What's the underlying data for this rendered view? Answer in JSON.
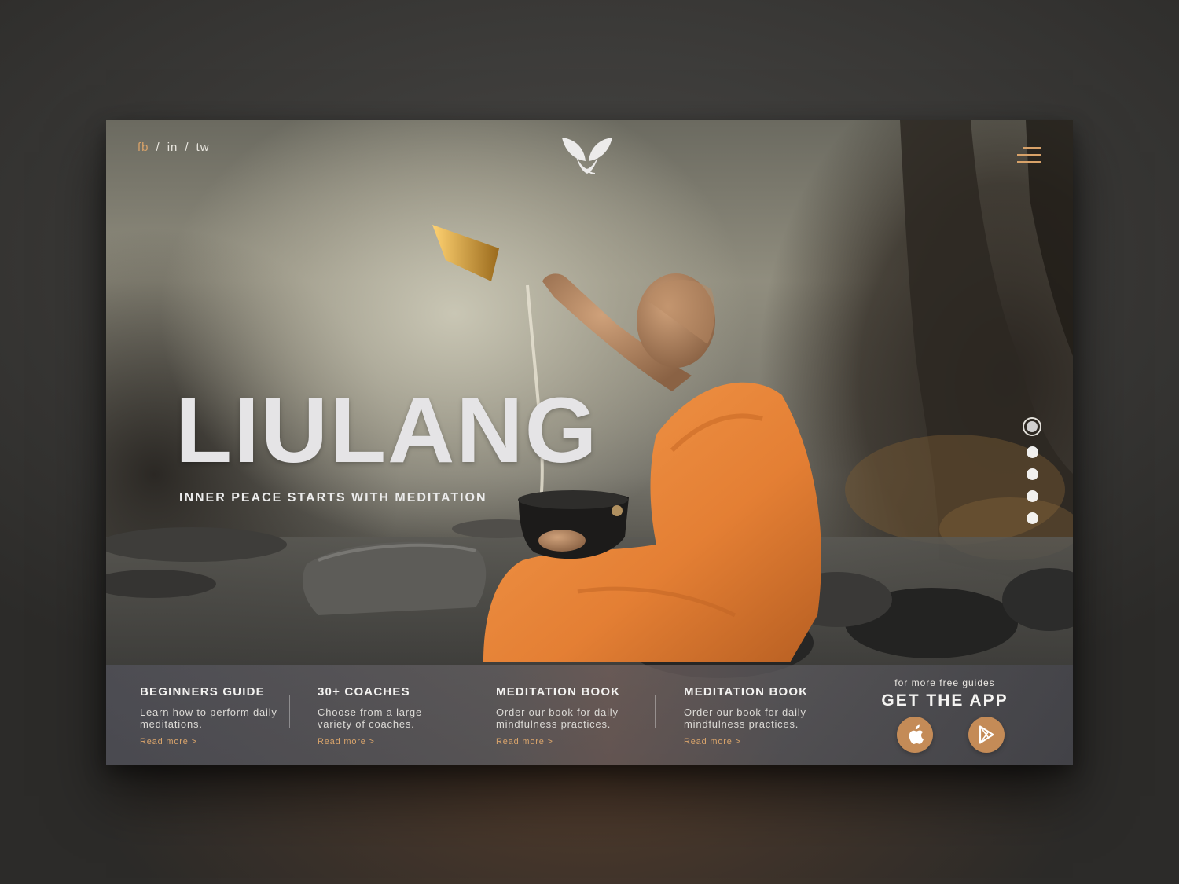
{
  "social": {
    "fb": "fb",
    "in": "in",
    "tw": "tw",
    "separator": "/"
  },
  "hero": {
    "title": "LIULANG",
    "subtitle": "INNER PEACE STARTS WITH MEDITATION"
  },
  "pager": {
    "count": 5,
    "active_index": 0
  },
  "cards": [
    {
      "title": "BEGINNERS GUIDE",
      "text": "Learn how to perform daily meditations.",
      "link": "Read more >"
    },
    {
      "title": "30+ COACHES",
      "text": "Choose from a large variety of coaches.",
      "link": "Read more >"
    },
    {
      "title": "MEDITATION BOOK",
      "text": "Order our book for daily mindfulness practices.",
      "link": "Read more >"
    },
    {
      "title": "MEDITATION BOOK",
      "text": "Order our book for daily mindfulness practices.",
      "link": "Read more >"
    }
  ],
  "app": {
    "tagline": "for more free guides",
    "title": "GET THE APP",
    "stores": [
      {
        "icon": "apple-icon"
      },
      {
        "icon": "play-store-icon"
      }
    ]
  },
  "colors": {
    "accent": "#d8a269",
    "store_button": "#c48b57",
    "robe": "#e8873c"
  }
}
